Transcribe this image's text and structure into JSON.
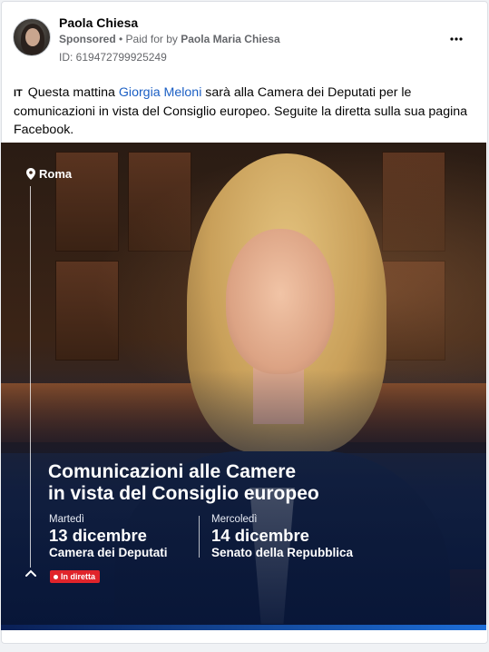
{
  "post": {
    "author": "Paola Chiesa",
    "sponsored_label": "Sponsored",
    "separator": " • ",
    "paid_for_prefix": "Paid for by ",
    "payer": "Paola Maria Chiesa",
    "ad_id": "ID: 619472799925249",
    "more_icon": "more-options-icon",
    "language_flag": "IT",
    "text_before_mention": " Questa mattina ",
    "mention": "Giorgia Meloni",
    "text_after_mention": " sarà alla Camera dei Deputati per le comunicazioni in vista del Consiglio europeo. Seguite la diretta sulla sua pagina Facebook."
  },
  "creative": {
    "location": "Roma",
    "headline_line1": "Comunicazioni alle Camere",
    "headline_line2": "in vista del Consiglio europeo",
    "events": [
      {
        "weekday": "Martedì",
        "date": "13 dicembre",
        "place": "Camera dei Deputati"
      },
      {
        "weekday": "Mercoledì",
        "date": "14 dicembre",
        "place": "Senato della Repubblica"
      }
    ],
    "live_badge": "In diretta",
    "colors": {
      "overlay_navy": "#0c1b3d",
      "live_red": "#e0242b",
      "mention_blue": "#1b5fc4"
    }
  }
}
